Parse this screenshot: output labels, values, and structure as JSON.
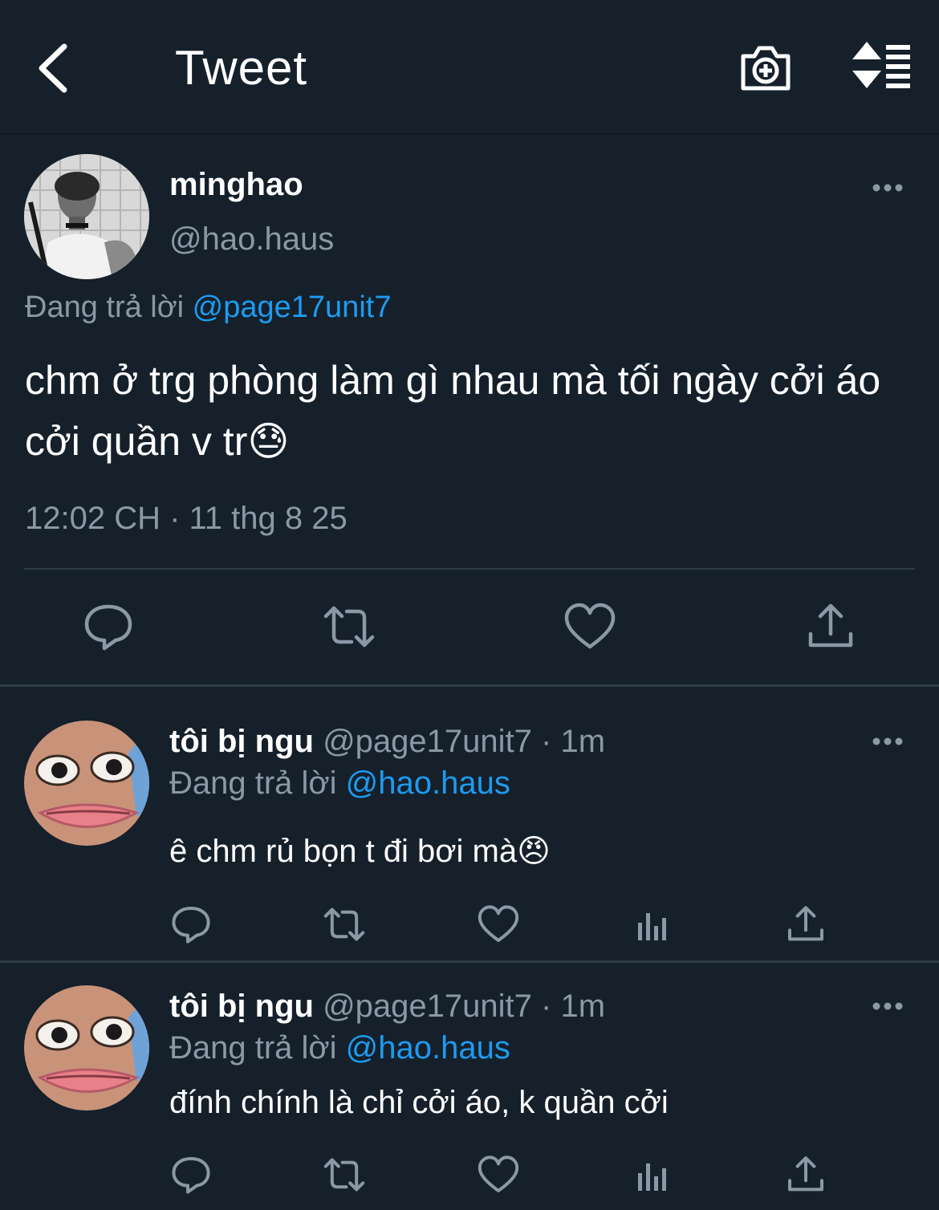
{
  "header": {
    "title": "Tweet"
  },
  "main_tweet": {
    "display_name": "minghao",
    "handle": "@hao.haus",
    "replying_prefix": "Đang trả lời",
    "replying_to": "@page17unit7",
    "text": "chm ở trg phòng làm gì nhau mà tối ngày cởi áo cởi quần v tr😓",
    "timestamp": "12:02 CH · 11 thg 8 25"
  },
  "replies": [
    {
      "display_name": "tôi bị ngu",
      "meta": "@page17unit7 · 1m",
      "replying_prefix": "Đang trả lời",
      "replying_to": "@hao.haus",
      "text": "ê chm rủ bọn t đi bơi mà😠"
    },
    {
      "display_name": "tôi bị ngu",
      "meta": "@page17unit7 · 1m",
      "replying_prefix": "Đang trả lời",
      "replying_to": "@hao.haus",
      "text": "đính chính là chỉ cởi áo, k quần cởi"
    }
  ],
  "colors": {
    "background": "#15202b",
    "accent": "#1d9bf0",
    "secondary_text": "#8b98a5",
    "divider": "#2f3b47"
  }
}
